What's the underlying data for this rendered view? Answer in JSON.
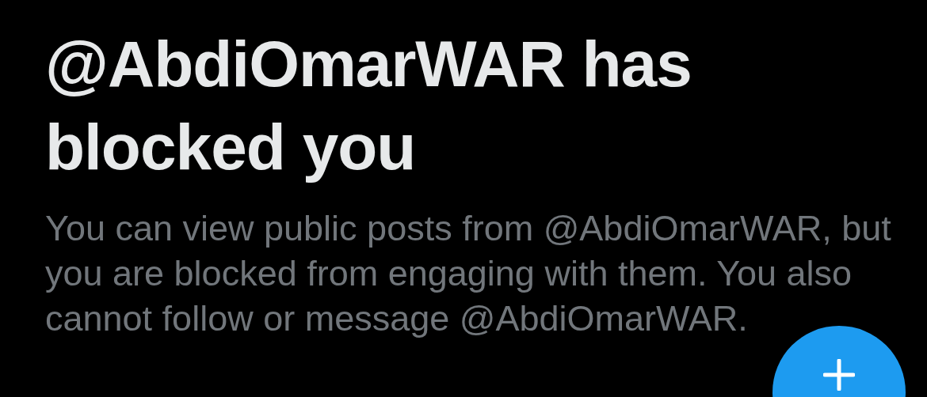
{
  "title": "@AbdiOmarWAR has blocked you",
  "message": "You can view public posts from @AbdiOmarWAR, but you are blocked from engaging with them. You also cannot follow or message @AbdiOmarWAR."
}
